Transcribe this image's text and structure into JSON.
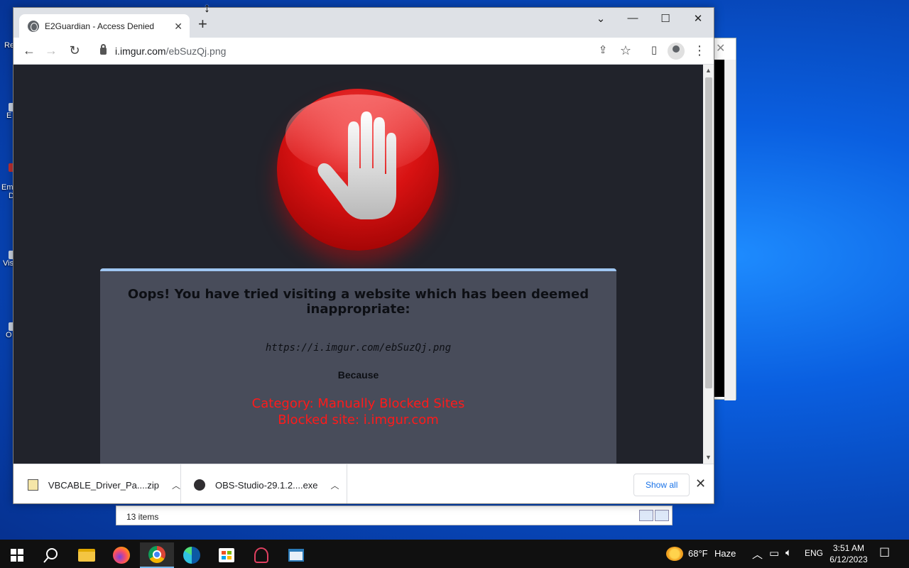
{
  "desktop": {
    "icon_labels": [
      "Re",
      "E",
      "Em",
      "D",
      "Vis",
      "O"
    ]
  },
  "explorer": {
    "status_items": "13 items"
  },
  "browser": {
    "tab": {
      "title": "E2Guardian - Access Denied",
      "close": "✕"
    },
    "new_tab": "+",
    "window_controls": {
      "dropdown": "⌄",
      "minimize": "—",
      "maximize": "☐",
      "close": "✕"
    },
    "address": {
      "host": "i.imgur.com",
      "path": "/ebSuzQj.png"
    }
  },
  "page": {
    "heading": "Oops! You have tried visiting a website which has been deemed inappropriate:",
    "blocked_url": "https://i.imgur.com/ebSuzQj.png",
    "because": "Because",
    "reason_category": "Category: Manually Blocked Sites",
    "reason_site": "Blocked site: i.imgur.com"
  },
  "downloads": {
    "items": [
      {
        "name": "VBCABLE_Driver_Pa....zip"
      },
      {
        "name": "OBS-Studio-29.1.2....exe"
      }
    ],
    "show_all": "Show all",
    "close": "✕"
  },
  "taskbar": {
    "weather": {
      "temp": "68°F",
      "condition": "Haze"
    },
    "language": "ENG",
    "time": "3:51 AM",
    "date": "6/12/2023"
  },
  "colors": {
    "page_bg": "#21232b",
    "panel_bg": "#484c5a",
    "panel_accent": "#9fc6f2",
    "reason_red": "#ff1a1a",
    "link_blue": "#1a73e8"
  }
}
